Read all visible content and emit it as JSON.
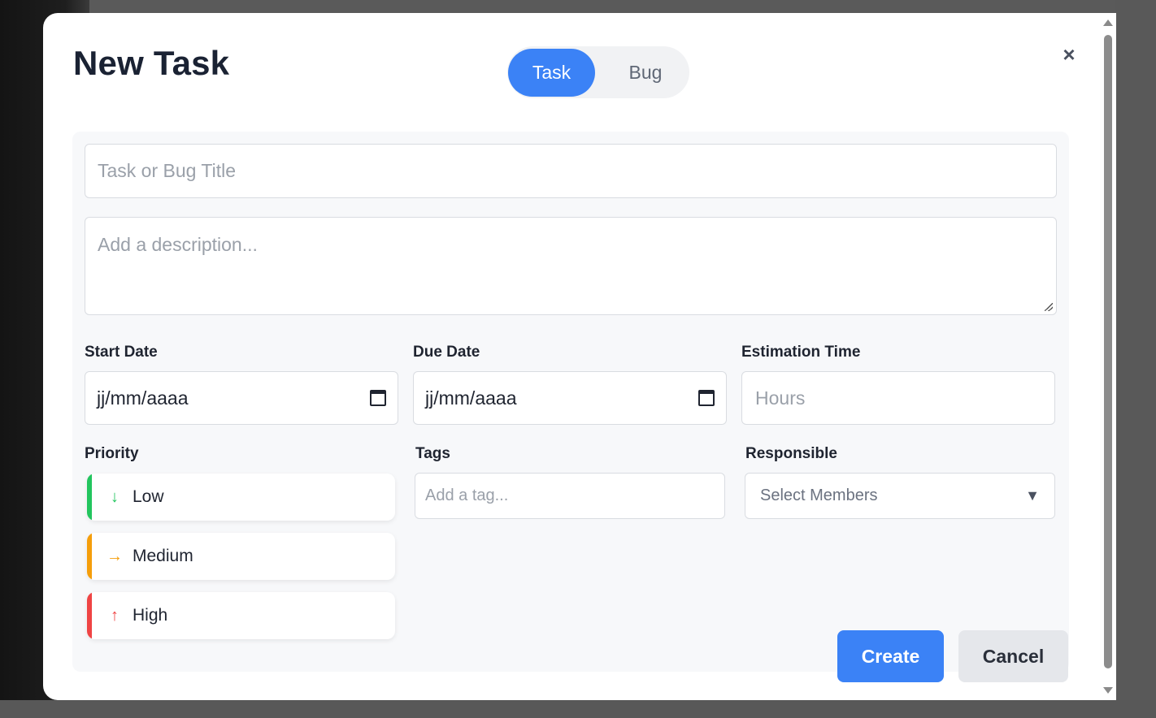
{
  "modal": {
    "title": "New Task",
    "close_symbol": "×",
    "type_toggle": {
      "options": [
        "Task",
        "Bug"
      ],
      "selected": "Task"
    }
  },
  "form": {
    "title_placeholder": "Task or Bug Title",
    "description_placeholder": "Add a description...",
    "start_date": {
      "label": "Start Date",
      "value": "jj/mm/aaaa"
    },
    "due_date": {
      "label": "Due Date",
      "value": "jj/mm/aaaa"
    },
    "estimation": {
      "label": "Estimation Time",
      "placeholder": "Hours"
    },
    "priority": {
      "label": "Priority",
      "options": [
        {
          "label": "Low",
          "icon": "arrow-down-icon",
          "glyph": "↓",
          "color": "#22c55e"
        },
        {
          "label": "Medium",
          "icon": "arrow-right-icon",
          "glyph": "→",
          "color": "#f59e0b"
        },
        {
          "label": "High",
          "icon": "arrow-up-icon",
          "glyph": "↑",
          "color": "#ef4444"
        }
      ]
    },
    "tags": {
      "label": "Tags",
      "placeholder": "Add a tag..."
    },
    "responsible": {
      "label": "Responsible",
      "placeholder": "Select Members",
      "arrow": "▼"
    }
  },
  "actions": {
    "create_label": "Create",
    "cancel_label": "Cancel"
  },
  "colors": {
    "accent": "#3b82f6",
    "cancel_bg": "#e5e7eb"
  }
}
